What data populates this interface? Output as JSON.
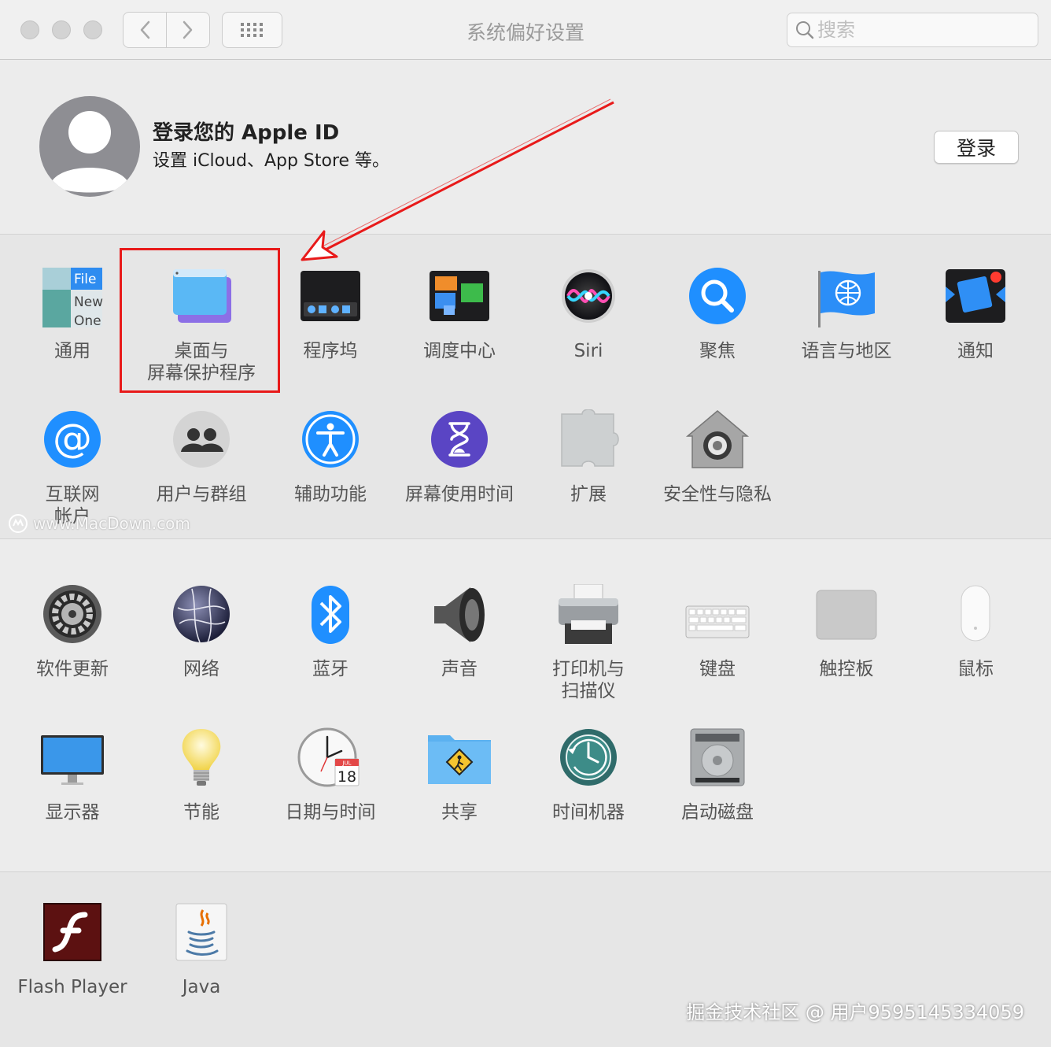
{
  "window": {
    "title": "系统偏好设置",
    "search_placeholder": "搜索"
  },
  "account": {
    "title": "登录您的 Apple ID",
    "subtitle": "设置 iCloud、App Store 等。",
    "signin_label": "登录"
  },
  "panes": {
    "general": "通用",
    "desktop_screensaver": "桌面与\n屏幕保护程序",
    "dock": "程序坞",
    "mission_control": "调度中心",
    "siri": "Siri",
    "spotlight": "聚焦",
    "language_region": "语言与地区",
    "notifications": "通知",
    "internet_accounts": "互联网\n帐户",
    "users_groups": "用户与群组",
    "accessibility": "辅助功能",
    "screen_time": "屏幕使用时间",
    "extensions": "扩展",
    "security_privacy": "安全性与隐私",
    "software_update": "软件更新",
    "network": "网络",
    "bluetooth": "蓝牙",
    "sound": "声音",
    "printers_scanners": "打印机与\n扫描仪",
    "keyboard": "键盘",
    "trackpad": "触控板",
    "mouse": "鼠标",
    "displays": "显示器",
    "energy_saver": "节能",
    "date_time": "日期与时间",
    "sharing": "共享",
    "time_machine": "时间机器",
    "startup_disk": "启动磁盘",
    "flash_player": "Flash Player",
    "java": "Java"
  },
  "icon_text": {
    "general_file": "File",
    "general_new": "New",
    "general_one": "One",
    "calendar_month": "JUL",
    "calendar_day": "18"
  },
  "watermarks": {
    "site": "www.MacDown.com",
    "credit": "掘金技术社区 @ 用户9595145334059"
  },
  "colors": {
    "highlight": "#e81a1a",
    "accent_blue": "#1f8fff"
  }
}
